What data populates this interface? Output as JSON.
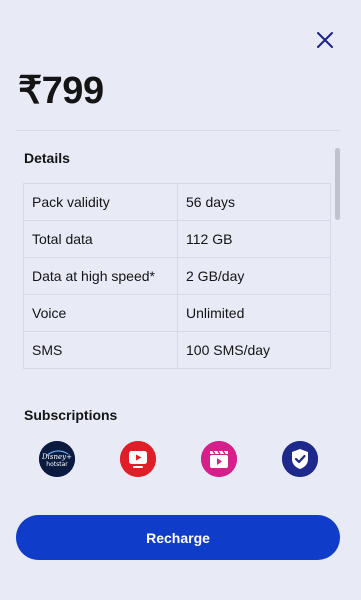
{
  "plan": {
    "price": "₹799"
  },
  "details": {
    "title": "Details",
    "rows": [
      {
        "key": "Pack validity",
        "value": "56 days"
      },
      {
        "key": "Total data",
        "value": "112 GB"
      },
      {
        "key": "Data at high speed*",
        "value": "2 GB/day"
      },
      {
        "key": "Voice",
        "value": "Unlimited"
      },
      {
        "key": "SMS",
        "value": "100 SMS/day"
      }
    ]
  },
  "subscriptions": {
    "title": "Subscriptions",
    "items": [
      {
        "icon": "disney-hotstar-icon",
        "text_top": "Disney+",
        "text_bottom": "hotstar",
        "color": "#0b1a3f"
      },
      {
        "icon": "jiotv-play-icon",
        "color": "#e01e27"
      },
      {
        "icon": "jiocinema-clapper-icon",
        "color": "#d4208a"
      },
      {
        "icon": "shield-check-icon",
        "color": "#1d2a8c"
      }
    ]
  },
  "actions": {
    "recharge_label": "Recharge"
  },
  "colors": {
    "background": "#e8eaf6",
    "accent": "#0f3cc9",
    "text": "#141414"
  }
}
